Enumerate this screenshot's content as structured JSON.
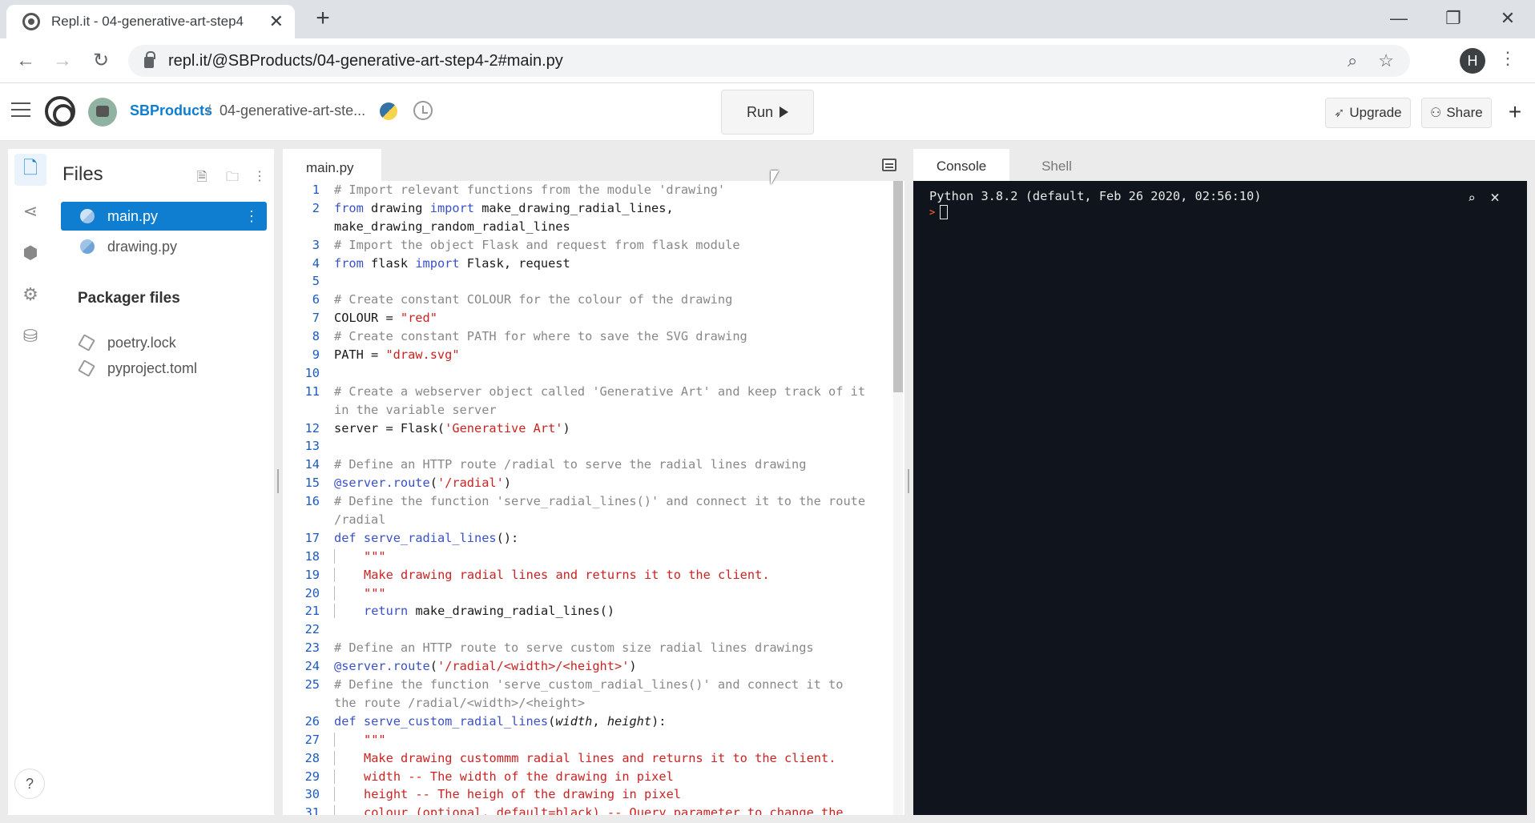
{
  "browser": {
    "tab_title": "Repl.it - 04-generative-art-step4",
    "tab_close": "✕",
    "new_tab": "+",
    "url": "repl.it/@SBProducts/04-generative-art-step4-2#main.py",
    "profile_initial": "H",
    "window_controls": [
      "—",
      "❐",
      "✕"
    ]
  },
  "header": {
    "owner": "SBProducts",
    "separator": "/",
    "repl_name": "04-generative-art-ste...",
    "run_label": "Run",
    "upgrade_label": "Upgrade",
    "share_label": "Share",
    "plus_label": "+"
  },
  "sidebar": {
    "title": "Files",
    "files": [
      {
        "name": "main.py",
        "active": true,
        "icon": "python-icon"
      },
      {
        "name": "drawing.py",
        "active": false,
        "icon": "python-icon"
      }
    ],
    "packager_title": "Packager files",
    "packager_files": [
      {
        "name": "poetry.lock",
        "icon": "package-icon"
      },
      {
        "name": "pyproject.toml",
        "icon": "package-icon"
      }
    ],
    "help_label": "?"
  },
  "editor": {
    "tab_label": "main.py",
    "lines": [
      {
        "n": "1",
        "html": "<span class='comment'># Import relevant functions from the module 'drawing'</span>"
      },
      {
        "n": "2",
        "html": "<span class='kw'>from</span> drawing <span class='kw'>import</span> make_drawing_radial_lines,"
      },
      {
        "n": "",
        "html": "make_drawing_random_radial_lines"
      },
      {
        "n": "3",
        "html": "<span class='comment'># Import the object Flask and request from flask module</span>"
      },
      {
        "n": "4",
        "html": "<span class='kw'>from</span> flask <span class='kw'>import</span> Flask, request"
      },
      {
        "n": "5",
        "html": ""
      },
      {
        "n": "6",
        "html": "<span class='comment'># Create constant COLOUR for the colour of the drawing</span>"
      },
      {
        "n": "7",
        "html": "COLOUR = <span class='str'>\"red\"</span>"
      },
      {
        "n": "8",
        "html": "<span class='comment'># Create constant PATH for where to save the SVG drawing</span>"
      },
      {
        "n": "9",
        "html": "PATH = <span class='str'>\"draw.svg\"</span>"
      },
      {
        "n": "10",
        "html": ""
      },
      {
        "n": "11",
        "html": "<span class='comment'># Create a webserver object called 'Generative Art' and keep track of it</span>"
      },
      {
        "n": "",
        "html": "<span class='comment'>in the variable server</span>"
      },
      {
        "n": "12",
        "html": "server = Flask(<span class='str'>'Generative Art'</span>)"
      },
      {
        "n": "13",
        "html": ""
      },
      {
        "n": "14",
        "html": "<span class='comment'># Define an HTTP route /radial to serve the radial lines drawing</span>"
      },
      {
        "n": "15",
        "html": "<span class='deco'>@server.route</span>(<span class='str'>'/radial'</span>)"
      },
      {
        "n": "16",
        "html": "<span class='comment'># Define the function 'serve_radial_lines()' and connect it to the route</span>"
      },
      {
        "n": "",
        "html": "<span class='comment'>/radial</span>"
      },
      {
        "n": "17",
        "html": "<span class='kw'>def</span> <span class='kw'>serve_radial_lines</span>():"
      },
      {
        "n": "18",
        "html": "<span class='indentguide'><span class='str'>\"\"\"</span></span>"
      },
      {
        "n": "19",
        "html": "<span class='indentguide'><span class='str'>Make drawing radial lines and returns it to the client.</span></span>"
      },
      {
        "n": "20",
        "html": "<span class='indentguide'><span class='str'>\"\"\"</span></span>"
      },
      {
        "n": "21",
        "html": "<span class='indentguide'><span class='kw'>return</span> make_drawing_radial_lines()</span>"
      },
      {
        "n": "22",
        "html": ""
      },
      {
        "n": "23",
        "html": "<span class='comment'># Define an HTTP route to serve custom size radial lines drawings</span>"
      },
      {
        "n": "24",
        "html": "<span class='deco'>@server.route</span>(<span class='str'>'/radial/&lt;width&gt;/&lt;height&gt;'</span>)"
      },
      {
        "n": "25",
        "html": "<span class='comment'># Define the function 'serve_custom_radial_lines()' and connect it to</span>"
      },
      {
        "n": "",
        "html": "<span class='comment'>the route /radial/&lt;width&gt;/&lt;height&gt;</span>"
      },
      {
        "n": "26",
        "html": "<span class='kw'>def</span> <span class='kw'>serve_custom_radial_lines</span>(<i>width</i>, <i>height</i>):"
      },
      {
        "n": "27",
        "html": "<span class='indentguide'><span class='str'>\"\"\"</span></span>"
      },
      {
        "n": "28",
        "html": "<span class='indentguide'><span class='str'>Make drawing custommm radial lines and returns it to the client.</span></span>"
      },
      {
        "n": "29",
        "html": "<span class='indentguide'><span class='str'>width -- The width of the drawing in pixel</span></span>"
      },
      {
        "n": "30",
        "html": "<span class='indentguide'><span class='str'>height -- The heigh of the drawing in pixel</span></span>"
      },
      {
        "n": "31",
        "html": "<span class='indentguide'><span class='str'>colour (optional, default=black) -- Query parameter to change the</span></span>"
      }
    ]
  },
  "console": {
    "tabs": [
      "Console",
      "Shell"
    ],
    "output": "Python 3.8.2 (default, Feb 26 2020, 02:56:10)",
    "prompt": ">"
  }
}
